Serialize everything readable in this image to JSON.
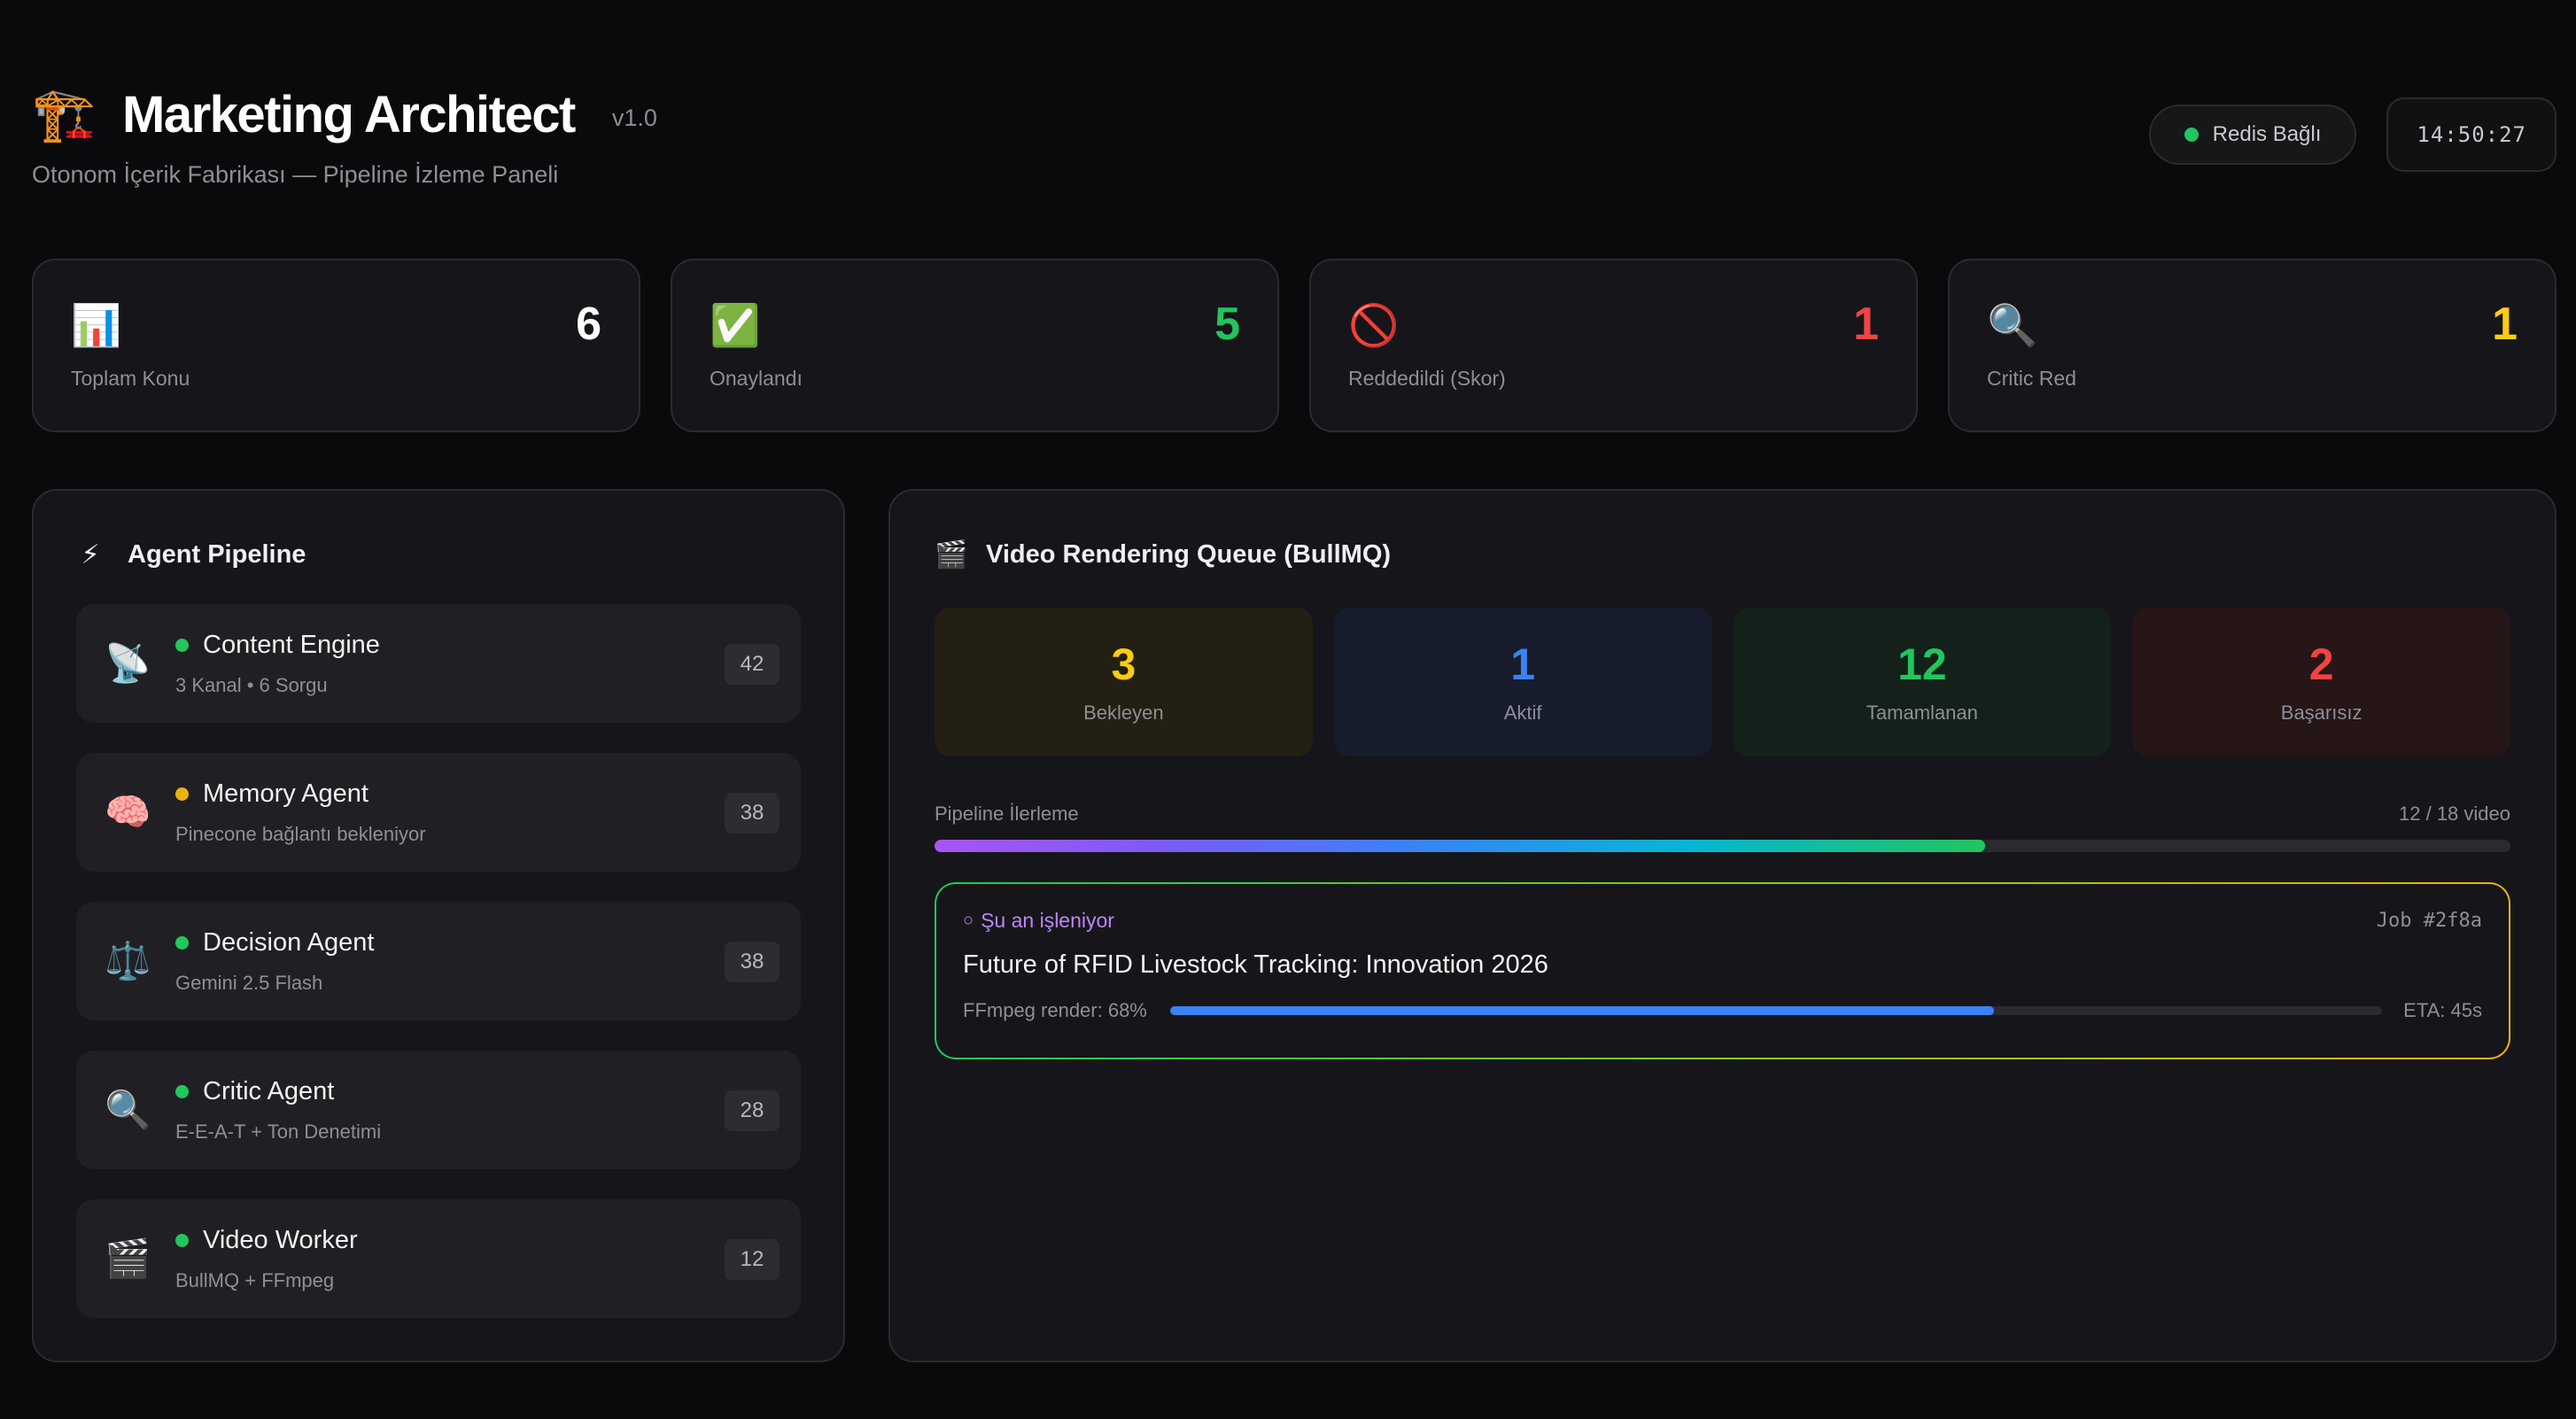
{
  "header": {
    "logo_icon": "🏗️",
    "title": "Marketing Architect",
    "version": "v1.0",
    "subtitle": "Otonom İçerik Fabrikası — Pipeline İzleme Paneli",
    "connection_status": "Redis Bağlı",
    "connection_color": "#22c55e",
    "clock": "14:50:27"
  },
  "stats": [
    {
      "icon": "📊",
      "icon_name": "bar-chart-icon",
      "value": "6",
      "label": "Toplam Konu",
      "color": "#ffffff"
    },
    {
      "icon": "✅",
      "icon_name": "check-icon",
      "value": "5",
      "label": "Onaylandı",
      "color": "#22c55e"
    },
    {
      "icon": "🚫",
      "icon_name": "prohibited-icon",
      "value": "1",
      "label": "Reddedildi (Skor)",
      "color": "#ef4444"
    },
    {
      "icon": "🔍",
      "icon_name": "magnifier-icon",
      "value": "1",
      "label": "Critic Red",
      "color": "#facc15"
    }
  ],
  "pipeline": {
    "icon": "⚡",
    "title": "Agent Pipeline",
    "agents": [
      {
        "icon": "📡",
        "icon_name": "satellite-icon",
        "name": "Content Engine",
        "desc": "3 Kanal • 6 Sorgu",
        "count": "42",
        "status_color": "#22c55e"
      },
      {
        "icon": "🧠",
        "icon_name": "brain-icon",
        "name": "Memory Agent",
        "desc": "Pinecone bağlantı bekleniyor",
        "count": "38",
        "status_color": "#eab308"
      },
      {
        "icon": "⚖️",
        "icon_name": "scales-icon",
        "name": "Decision Agent",
        "desc": "Gemini 2.5 Flash",
        "count": "38",
        "status_color": "#22c55e"
      },
      {
        "icon": "🔍",
        "icon_name": "magnifier-icon",
        "name": "Critic Agent",
        "desc": "E-E-A-T + Ton Denetimi",
        "count": "28",
        "status_color": "#22c55e"
      },
      {
        "icon": "🎬",
        "icon_name": "clapper-icon",
        "name": "Video Worker",
        "desc": "BullMQ + FFmpeg",
        "count": "12",
        "status_color": "#22c55e"
      }
    ]
  },
  "queue": {
    "icon": "🎬",
    "title": "Video Rendering Queue (BullMQ)",
    "boxes": [
      {
        "value": "3",
        "label": "Bekleyen",
        "color": "#facc15",
        "bg": "#231f12"
      },
      {
        "value": "1",
        "label": "Aktif",
        "color": "#3b82f6",
        "bg": "#161c2c"
      },
      {
        "value": "12",
        "label": "Tamamlanan",
        "color": "#22c55e",
        "bg": "#13211a"
      },
      {
        "value": "2",
        "label": "Başarısız",
        "color": "#ef4444",
        "bg": "#261618"
      }
    ],
    "progress_label": "Pipeline İlerleme",
    "progress_text": "12 / 18 video",
    "progress_fraction": 0.6667,
    "current_job": {
      "status_icon": "○",
      "status": "Şu an işleniyor",
      "id": "Job #2f8a",
      "title": "Future of RFID Livestock Tracking: Innovation 2026",
      "render_text": "FFmpeg render: 68%",
      "render_fraction": 0.68,
      "eta": "ETA: 45s"
    }
  }
}
